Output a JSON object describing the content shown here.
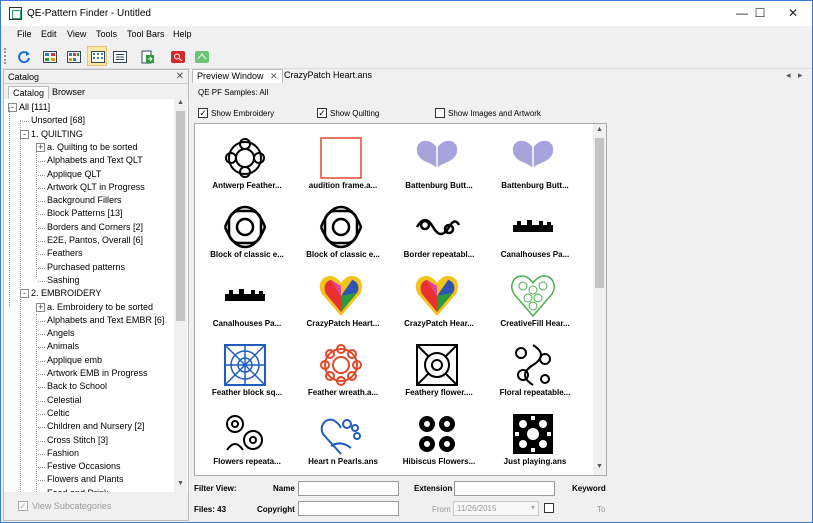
{
  "window": {
    "title": "QE-Pattern Finder - Untitled",
    "minimize": "—",
    "maximize": "☐",
    "close": "✕"
  },
  "menu": [
    "File",
    "Edit",
    "View",
    "Tools",
    "Tool Bars",
    "Help"
  ],
  "left_panel": {
    "title": "Catalog",
    "close": "✕",
    "tabs": [
      "Catalog",
      "Browser"
    ],
    "tree": [
      {
        "label": "All [111]",
        "level": 0,
        "expander": "-"
      },
      {
        "label": "Unsorted [68]",
        "level": 1
      },
      {
        "label": "1. QUILTING",
        "level": 1,
        "expander": "-"
      },
      {
        "label": "a. Quilting to be sorted",
        "level": 2,
        "expander": "+"
      },
      {
        "label": "Alphabets and Text QLT",
        "level": 2
      },
      {
        "label": "Applique QLT",
        "level": 2
      },
      {
        "label": "Artwork QLT in Progress",
        "level": 2
      },
      {
        "label": "Background Fillers",
        "level": 2
      },
      {
        "label": "Block Patterns [13]",
        "level": 2
      },
      {
        "label": "Borders and Corners [2]",
        "level": 2
      },
      {
        "label": "E2E, Pantos, Overall [6]",
        "level": 2
      },
      {
        "label": "Feathers",
        "level": 2
      },
      {
        "label": "Purchased patterns",
        "level": 2
      },
      {
        "label": "Sashing",
        "level": 2
      },
      {
        "label": "2. EMBROIDERY",
        "level": 1,
        "expander": "-"
      },
      {
        "label": "a. Embroidery to be sorted",
        "level": 2,
        "expander": "+"
      },
      {
        "label": "Alphabets and Text EMBR [6]",
        "level": 2
      },
      {
        "label": "Angels",
        "level": 2
      },
      {
        "label": "Animals",
        "level": 2
      },
      {
        "label": "Applique emb",
        "level": 2
      },
      {
        "label": "Artwork EMB in Progress",
        "level": 2
      },
      {
        "label": "Back to School",
        "level": 2
      },
      {
        "label": "Celestial",
        "level": 2
      },
      {
        "label": "Celtic",
        "level": 2
      },
      {
        "label": "Children and Nursery [2]",
        "level": 2
      },
      {
        "label": "Cross Stitch [3]",
        "level": 2
      },
      {
        "label": "Fashion",
        "level": 2
      },
      {
        "label": "Festive Occasions",
        "level": 2
      },
      {
        "label": "Flowers and Plants",
        "level": 2
      },
      {
        "label": "Food and Drink",
        "level": 2
      }
    ],
    "view_subcategories": "View Subcategories"
  },
  "doc_tabs": [
    {
      "label": "Preview Window",
      "close": "✕"
    },
    {
      "label": "CrazyPatch Heart.ans"
    }
  ],
  "doc_tab_arrows": {
    "left": "◂",
    "right": "▸"
  },
  "preview": {
    "samples_label": "QE PF Samples: All",
    "show_embroidery": {
      "label": "Show Embroidery",
      "checked": true
    },
    "show_quilting": {
      "label": "Show Quilting",
      "checked": true
    },
    "show_images": {
      "label": "Show Images and Artwork",
      "checked": false
    },
    "thumbnails": [
      {
        "label": "Antwerp Feather...",
        "icon": "medallion-icon"
      },
      {
        "label": "audition frame.a...",
        "icon": "frame-icon"
      },
      {
        "label": "Battenburg Butt...",
        "icon": "butterfly-icon"
      },
      {
        "label": "Battenburg Butt...",
        "icon": "butterfly-icon"
      },
      {
        "label": "Block of classic e...",
        "icon": "block-icon"
      },
      {
        "label": "Block of classic e...",
        "icon": "block-icon"
      },
      {
        "label": "Border repeatabl...",
        "icon": "border-icon"
      },
      {
        "label": "Canalhouses Pa...",
        "icon": "houses-icon"
      },
      {
        "label": "Canalhouses Pa...",
        "icon": "houses-icon"
      },
      {
        "label": "CrazyPatch Heart...",
        "icon": "heart-icon"
      },
      {
        "label": "CrazyPatch Hear...",
        "icon": "heart-icon"
      },
      {
        "label": "CreativeFill Hear...",
        "icon": "green-heart-icon"
      },
      {
        "label": "Feather block sq...",
        "icon": "blue-square-icon"
      },
      {
        "label": "Feather wreath.a...",
        "icon": "wreath-icon"
      },
      {
        "label": "Feathery flower....",
        "icon": "flower-square-icon"
      },
      {
        "label": "Floral repeatable...",
        "icon": "floral-icon"
      },
      {
        "label": "Flowers repeata...",
        "icon": "flowers-icon"
      },
      {
        "label": "Heart n Pearls.ans",
        "icon": "pearls-icon"
      },
      {
        "label": "Hibiscus Flowers...",
        "icon": "hibiscus-icon"
      },
      {
        "label": "Just playing.ans",
        "icon": "lace-square-icon"
      }
    ],
    "filter": {
      "filter_view": "Filter View:",
      "files": "Files: 43",
      "name_label": "Name",
      "extension_label": "Extension",
      "keyword_label": "Keyword",
      "copyright_label": "Copyright",
      "from_label": "From",
      "from_value": "11/26/2015",
      "to_label": "To"
    }
  },
  "colors": {
    "accent": "#3a7bd5",
    "butterfly": "#a7a3dc",
    "heart_red": "#e83030",
    "heart_yellow": "#f4c21a",
    "heart_blue": "#2f55b4",
    "green": "#4caf50",
    "blue": "#1e5dbf",
    "red_line": "#e04a2a"
  }
}
